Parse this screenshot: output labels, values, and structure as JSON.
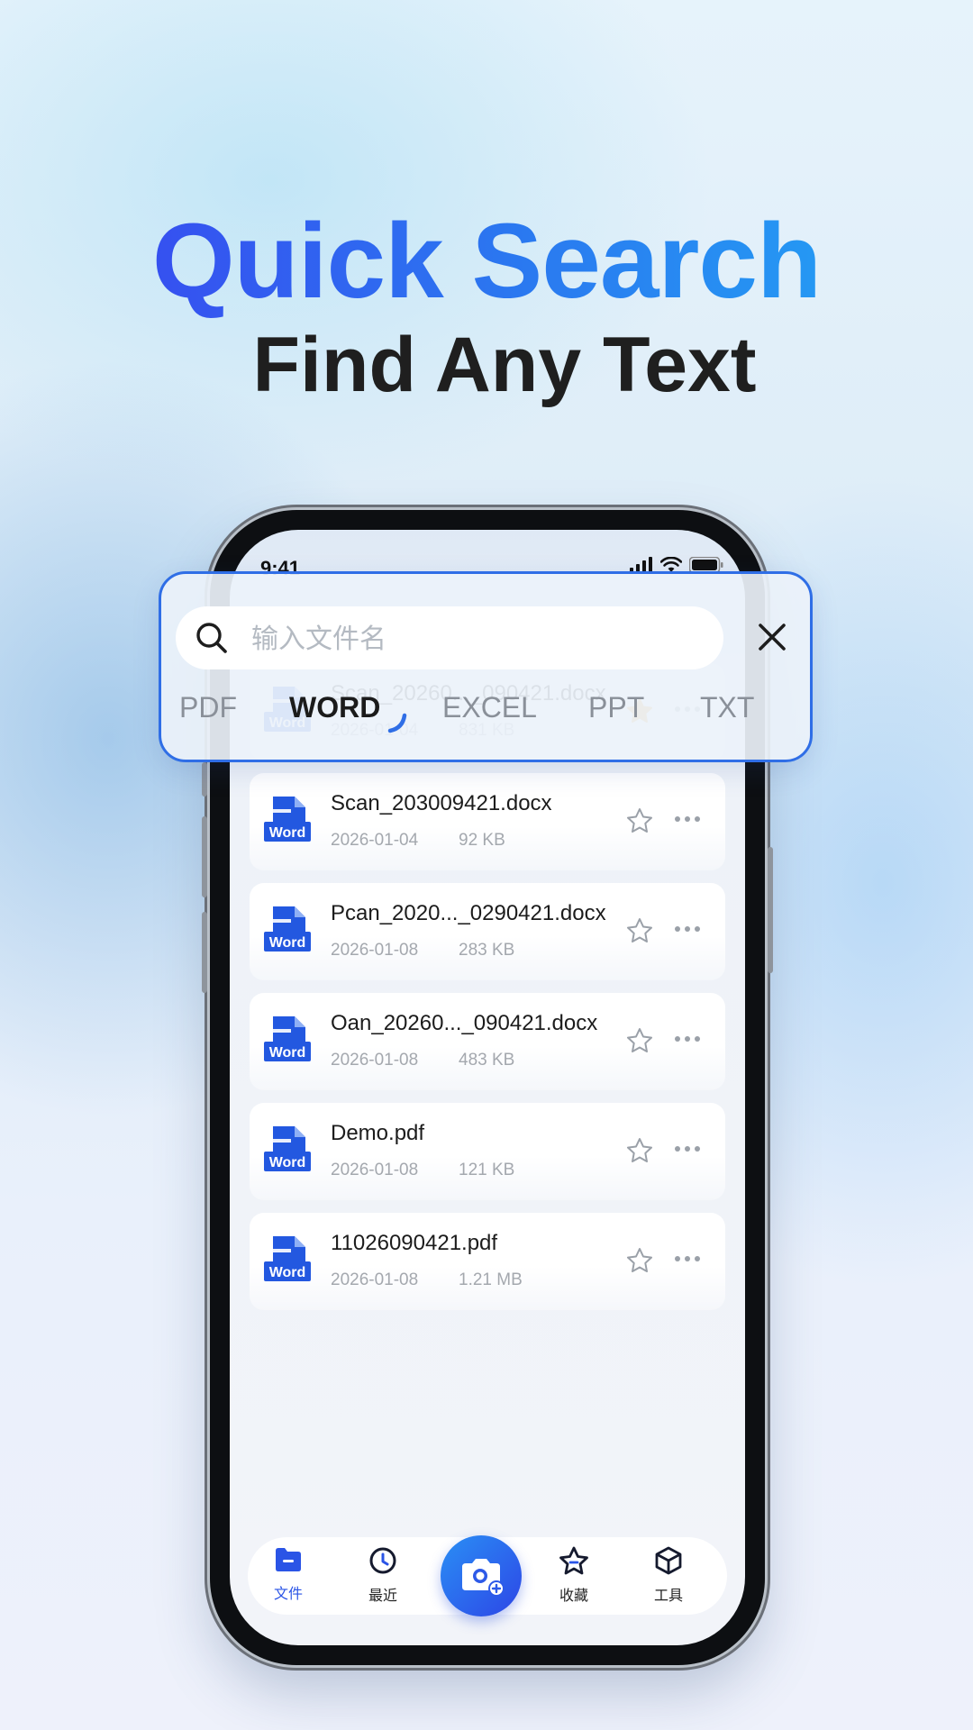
{
  "headline": {
    "line1": "Quick Search",
    "line2": "Find Any Text"
  },
  "status_bar": {
    "time": "9:41"
  },
  "search": {
    "placeholder": "输入文件名",
    "file_types": [
      "PDF",
      "WORD",
      "EXCEL",
      "PPT",
      "TXT"
    ],
    "selected_type": "WORD"
  },
  "files": [
    {
      "name": "Scan_20260..._090421.docx",
      "date": "2026-01-04",
      "size": "831 KB",
      "favorite": true,
      "badge": "Word"
    },
    {
      "name": "Scan_203009421.docx",
      "date": "2026-01-04",
      "size": "92 KB",
      "favorite": false,
      "badge": "Word"
    },
    {
      "name": "Pcan_2020..._0290421.docx",
      "date": "2026-01-08",
      "size": "283 KB",
      "favorite": false,
      "badge": "Word"
    },
    {
      "name": "Oan_20260..._090421.docx",
      "date": "2026-01-08",
      "size": "483 KB",
      "favorite": false,
      "badge": "Word"
    },
    {
      "name": "Demo.pdf",
      "date": "2026-01-08",
      "size": "121 KB",
      "favorite": false,
      "badge": "Word"
    },
    {
      "name": "11026090421.pdf",
      "date": "2026-01-08",
      "size": "1.21 MB",
      "favorite": false,
      "badge": "Word"
    }
  ],
  "tab_bar": {
    "items": [
      {
        "label": "文件",
        "icon": "folder-icon",
        "active": true
      },
      {
        "label": "最近",
        "icon": "clock-icon",
        "active": false
      },
      {
        "label": "收藏",
        "icon": "star-icon",
        "active": false
      },
      {
        "label": "工具",
        "icon": "cube-icon",
        "active": false
      }
    ],
    "center_icon": "camera-plus-icon"
  },
  "colors": {
    "accent": "#2f6ee6",
    "headline_gradient_start": "#3a40f0",
    "headline_gradient_end": "#22a8f5",
    "favorite_star": "#e9a93c",
    "word_blue": "#2358e0"
  }
}
